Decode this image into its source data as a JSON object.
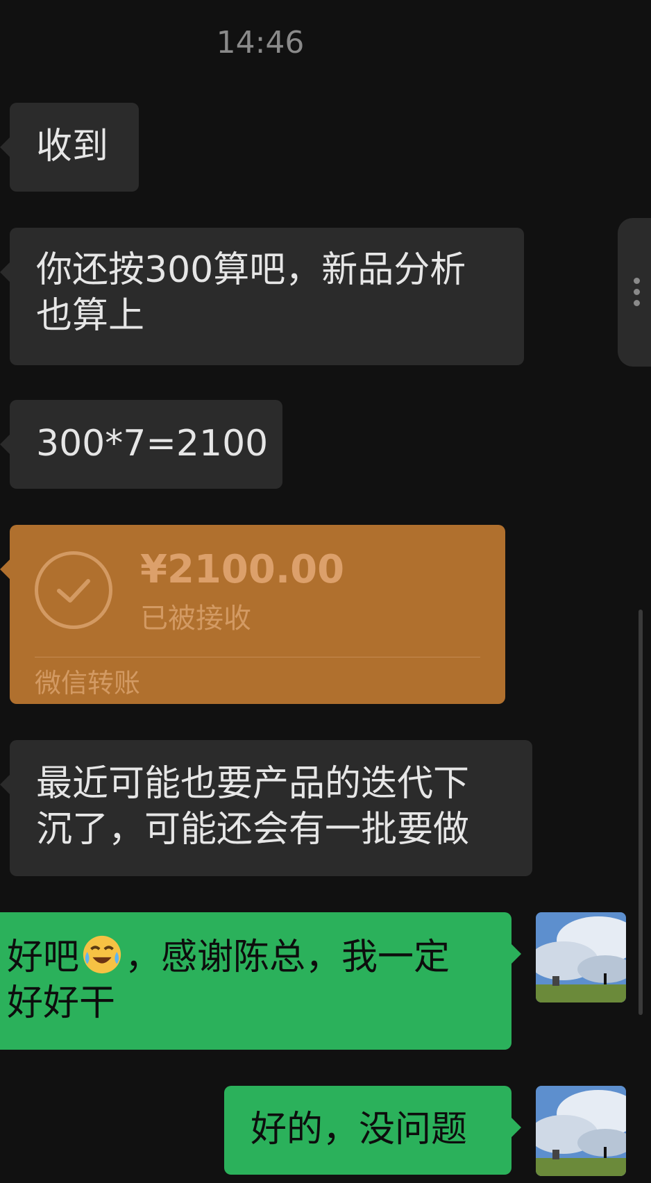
{
  "chat": {
    "timestamp": "14:46",
    "messages": [
      {
        "side": "left",
        "text": "收到"
      },
      {
        "side": "left",
        "text_line1": "你还按300算吧，新品分析",
        "text_line2": "也算上"
      },
      {
        "side": "left",
        "text": "300*7=2100"
      },
      {
        "side": "left",
        "type": "transfer",
        "amount": "¥2100.00",
        "status": "已被接收",
        "footer": "微信转账"
      },
      {
        "side": "left",
        "text_line1": "最近可能也要产品的迭代下",
        "text_line2": "沉了，可能还会有一批要做"
      },
      {
        "side": "right",
        "text_part1": "好吧",
        "emoji": "crying-laughing-face",
        "text_part2": "，感谢陈总，我一定",
        "text_line2": "好好干"
      },
      {
        "side": "right",
        "text": "好的，没问题"
      }
    ]
  },
  "colors": {
    "background": "#111111",
    "incoming_bubble": "#2b2b2b",
    "outgoing_bubble": "#2bb15b",
    "transfer_card": "#b0702e"
  },
  "icons": {
    "transfer_check": "check-circle-icon",
    "side_handle": "more-vertical-icon"
  }
}
